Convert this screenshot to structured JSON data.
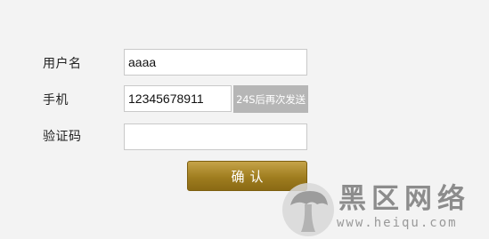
{
  "form": {
    "username_label": "用户名",
    "username_value": "aaaa",
    "phone_label": "手机",
    "phone_value": "12345678911",
    "send_code_button_label": "24S后再次发送",
    "code_label": "验证码",
    "code_value": "",
    "confirm_button_label": "确认"
  },
  "watermark": {
    "title": "黑区网络",
    "url": "www.heiqu.com",
    "logo_icon": "mushroom-icon"
  },
  "colors": {
    "background": "#f3f3f3",
    "confirm_button": "#a5832a",
    "send_button": "#b6b6b6"
  }
}
